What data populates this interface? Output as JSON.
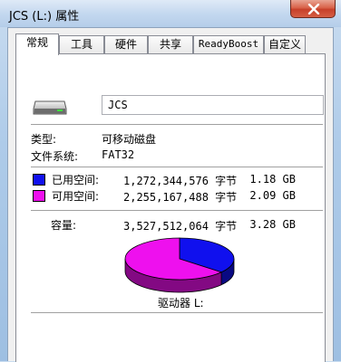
{
  "window": {
    "title": "JCS (L:) 属性"
  },
  "tabs": [
    {
      "label": "常规"
    },
    {
      "label": "工具"
    },
    {
      "label": "硬件"
    },
    {
      "label": "共享"
    },
    {
      "label": "ReadyBoost"
    },
    {
      "label": "自定义"
    }
  ],
  "general": {
    "name_value": "JCS",
    "type_label": "类型:",
    "type_value": "可移动磁盘",
    "fs_label": "文件系统:",
    "fs_value": "FAT32",
    "used": {
      "label": "已用空间:",
      "bytes": "1,272,344,576 字节",
      "size": "1.18 GB",
      "color": "#1010ee"
    },
    "free": {
      "label": "可用空间:",
      "bytes": "2,255,167,488 字节",
      "size": "2.09 GB",
      "color": "#ee10ee"
    },
    "capacity": {
      "label": "容量:",
      "bytes": "3,527,512,064 字节",
      "size": "3.28 GB"
    },
    "drive_label": "驱动器 L:"
  },
  "chart_data": {
    "type": "pie",
    "categories": [
      "已用空间",
      "可用空间"
    ],
    "values": [
      1272344576,
      2255167488
    ],
    "colors": [
      "#1010ee",
      "#ee10ee"
    ]
  }
}
